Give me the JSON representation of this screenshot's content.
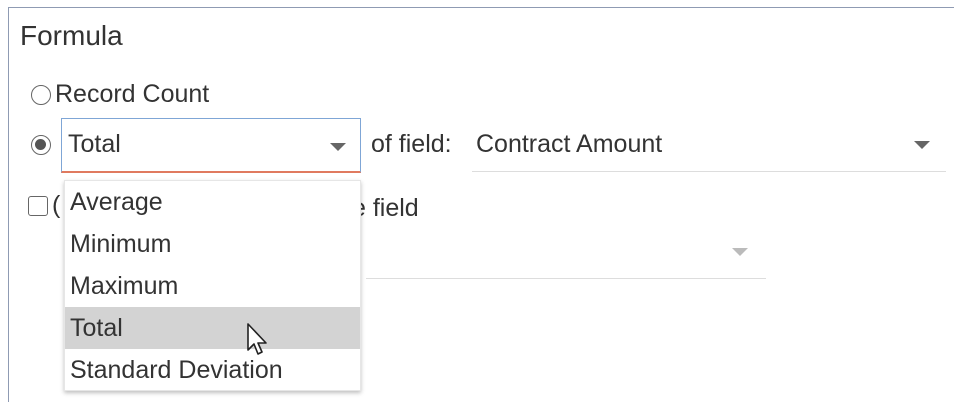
{
  "panel": {
    "title": "Formula"
  },
  "formula": {
    "record_count_label": "Record Count",
    "record_count_checked": false,
    "aggregate_checked": true,
    "aggregate_selected": "Total",
    "of_field_label": "of field:",
    "field_selected": "Contract Amount",
    "checkbox_checked": false,
    "checkbox_label_partial_left": "(",
    "checkbox_label_partial_right": "e field"
  },
  "aggregate_dropdown": {
    "options": [
      "Average",
      "Minimum",
      "Maximum",
      "Total",
      "Standard Deviation"
    ],
    "highlighted_index": 3
  },
  "icons": {
    "caret": "chevron-down-icon",
    "cursor": "mouse-pointer-icon"
  },
  "colors": {
    "select_border": "#7fa6d6",
    "select_underline": "#e07a5f",
    "highlight": "#d3d3d3",
    "text": "#333333"
  }
}
